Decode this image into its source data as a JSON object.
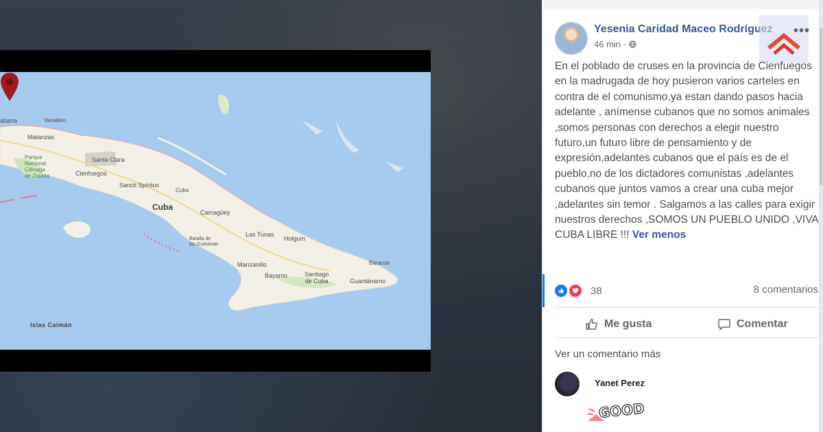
{
  "map": {
    "labels": {
      "havana": "abana",
      "varadero": "Varadero",
      "matanzas": "Matanzas",
      "park": "Parque\nNacional\nCiénaga\nde Zapata",
      "santa_clara": "Santa Clara",
      "cienfuegos": "Cienfuegos",
      "sancti_spiritus": "Sancti Spíritus",
      "cuba_small": "Cuba",
      "cuba": "Cuba",
      "camaguey": "Camagüey",
      "las_tunas": "Las Tunas",
      "holguin": "Holguín",
      "bataba": "Batalla de\nlas Guásimas",
      "manzanillo": "Manzanillo",
      "bayamo": "Bayamo",
      "santiago": "Santiago\nde Cuba",
      "baracoa": "Baracoa",
      "guantanamo": "Guantánamo",
      "islas_caiman": "Islas Caimán"
    }
  },
  "post": {
    "author": "Yesenia Caridad Maceo Rodríguez",
    "time": "46 min",
    "more_icon": "•••",
    "text": "En el poblado de cruses en la provincia de Cienfuegos en la madrugada de hoy pusieron varios carteles en contra de el comunismo,ya estan dando pasos hacia adelante , anímense cubanos que no somos animales ,somos personas con derechos a elegir nuestro futuro,un futuro libre de pensamiento y de expresión,adelantes cubanos que el país es de el pueblo,no de los dictadores comunistas ,adelantes cubanos que juntos vamos a crear una cuba mejor ,adelantes sin temor . Salgamos a las calles para exigir nuestros derechos ,SOMOS UN PUEBLO UNIDO ,VIVA CUBA LIBRE !!! ",
    "see_less": "Ver menos",
    "reaction_count": "38",
    "comment_count": "8 comentarios",
    "like_label": "Me gusta",
    "comment_label": "Comentar",
    "view_more_comments": "Ver un comentario más",
    "commenter": "Yanet Perez",
    "sticker_text": "GOOD"
  },
  "colors": {
    "link_blue": "#385898",
    "like_blue": "#1877f2",
    "love_red": "#f33e58",
    "pin_red": "#a11a1f",
    "sea": "#a6c9ee",
    "land": "#f2f0e6"
  }
}
